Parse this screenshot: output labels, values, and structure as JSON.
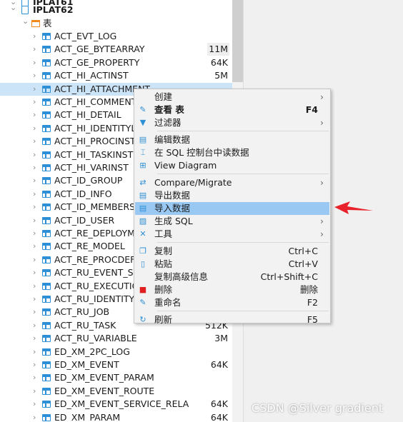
{
  "tree": {
    "partial_top": "IPLAT61",
    "schema": "IPLAT62",
    "folder": "表",
    "tables": [
      {
        "name": "ACT_EVT_LOG",
        "size": ""
      },
      {
        "name": "ACT_GE_BYTEARRAY",
        "size": "11M"
      },
      {
        "name": "ACT_GE_PROPERTY",
        "size": "64K"
      },
      {
        "name": "ACT_HI_ACTINST",
        "size": "5M"
      },
      {
        "name": "ACT_HI_ATTACHMENT",
        "size": "",
        "selected": true
      },
      {
        "name": "ACT_HI_COMMENT",
        "size": ""
      },
      {
        "name": "ACT_HI_DETAIL",
        "size": ""
      },
      {
        "name": "ACT_HI_IDENTITYLI",
        "size": ""
      },
      {
        "name": "ACT_HI_PROCINST",
        "size": ""
      },
      {
        "name": "ACT_HI_TASKINST",
        "size": ""
      },
      {
        "name": "ACT_HI_VARINST",
        "size": ""
      },
      {
        "name": "ACT_ID_GROUP",
        "size": ""
      },
      {
        "name": "ACT_ID_INFO",
        "size": ""
      },
      {
        "name": "ACT_ID_MEMBERSHI",
        "size": ""
      },
      {
        "name": "ACT_ID_USER",
        "size": ""
      },
      {
        "name": "ACT_RE_DEPLOYME",
        "size": ""
      },
      {
        "name": "ACT_RE_MODEL",
        "size": ""
      },
      {
        "name": "ACT_RE_PROCDEF",
        "size": ""
      },
      {
        "name": "ACT_RU_EVENT_SU",
        "size": ""
      },
      {
        "name": "ACT_RU_EXECUTIO",
        "size": ""
      },
      {
        "name": "ACT_RU_IDENTITYL",
        "size": ""
      },
      {
        "name": "ACT_RU_JOB",
        "size": ""
      },
      {
        "name": "ACT_RU_TASK",
        "size": "512K"
      },
      {
        "name": "ACT_RU_VARIABLE",
        "size": "3M"
      },
      {
        "name": "ED_XM_2PC_LOG",
        "size": ""
      },
      {
        "name": "ED_XM_EVENT",
        "size": "64K"
      },
      {
        "name": "ED_XM_EVENT_PARAM",
        "size": ""
      },
      {
        "name": "ED_XM_EVENT_ROUTE",
        "size": ""
      },
      {
        "name": "ED_XM_EVENT_SERVICE_RELA",
        "size": "64K"
      },
      {
        "name": "ED_XM_PARAM",
        "size": "64K"
      }
    ]
  },
  "menu": {
    "items": [
      {
        "label": "创建",
        "icon": "none",
        "submenu": true
      },
      {
        "label": "查看 表",
        "icon": "pencil-icon",
        "shortcut": "F4",
        "bold": true
      },
      {
        "label": "过滤器",
        "icon": "filter-icon",
        "submenu": true
      },
      {
        "sep": true
      },
      {
        "label": "编辑数据",
        "icon": "edit-data-icon"
      },
      {
        "label": "在 SQL 控制台中读数据",
        "icon": "sql-console-icon"
      },
      {
        "label": "View Diagram",
        "icon": "diagram-icon"
      },
      {
        "sep": true
      },
      {
        "label": "Compare/Migrate",
        "icon": "compare-icon",
        "submenu": true
      },
      {
        "label": "导出数据",
        "icon": "export-icon"
      },
      {
        "label": "导入数据",
        "icon": "import-icon",
        "highlighted": true
      },
      {
        "label": "生成 SQL",
        "icon": "sql-file-icon",
        "submenu": true
      },
      {
        "label": "工具",
        "icon": "tools-icon",
        "submenu": true
      },
      {
        "sep": true
      },
      {
        "label": "复制",
        "icon": "copy-icon",
        "shortcut": "Ctrl+C"
      },
      {
        "label": "粘贴",
        "icon": "paste-icon",
        "shortcut": "Ctrl+V"
      },
      {
        "label": "复制高级信息",
        "icon": "none",
        "shortcut": "Ctrl+Shift+C"
      },
      {
        "label": "删除",
        "icon": "trash-icon",
        "shortcut": "删除"
      },
      {
        "label": "重命名",
        "icon": "rename-icon",
        "shortcut": "F2"
      },
      {
        "sep": true
      },
      {
        "label": "刷新",
        "icon": "refresh-icon",
        "shortcut": "F5"
      }
    ]
  },
  "colors": {
    "selection": "#cce4f7",
    "menu_highlight": "#99c9f3",
    "arrow": "#e8212a",
    "table_icon": "#2d8fd5"
  },
  "watermark": "CSDN @Silver gradient"
}
